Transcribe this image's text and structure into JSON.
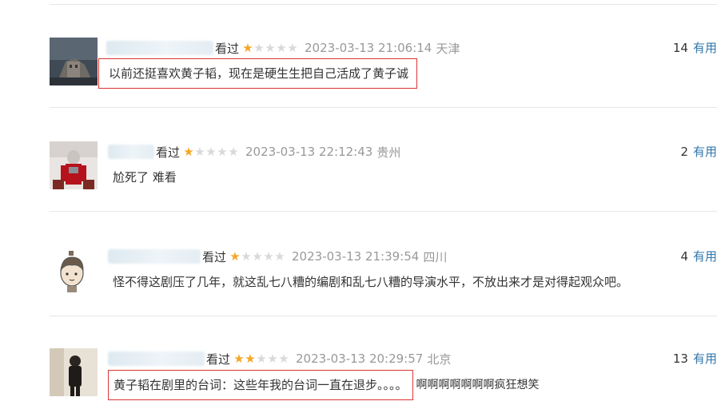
{
  "comments": [
    {
      "status": "看过",
      "rating": 1,
      "time": "2023-03-13 21:06:14",
      "location": "天津",
      "votes": "14",
      "useful_label": "有用",
      "text": "以前还挺喜欢黄子韬，现在是硬生生把自己活成了黄子诚",
      "text_after": ""
    },
    {
      "status": "看过",
      "rating": 1,
      "time": "2023-03-13 22:12:43",
      "location": "贵州",
      "votes": "2",
      "useful_label": "有用",
      "text": "尬死了 难看",
      "text_after": ""
    },
    {
      "status": "看过",
      "rating": 1,
      "time": "2023-03-13 21:39:54",
      "location": "四川",
      "votes": "4",
      "useful_label": "有用",
      "text": "怪不得这剧压了几年，就这乱七八糟的编剧和乱七八糟的导演水平，不放出来才是对得起观众吧。",
      "text_after": ""
    },
    {
      "status": "看过",
      "rating": 2,
      "time": "2023-03-13 20:29:57",
      "location": "北京",
      "votes": "13",
      "useful_label": "有用",
      "text": "黄子韬在剧里的台词：这些年我的台词一直在退步。。。。",
      "text_after": "啊啊啊啊啊啊啊疯狂想笑"
    }
  ],
  "colors": {
    "star_on": "#f5a623",
    "star_off": "#d9d9d9",
    "highlight_border": "#dd3333",
    "link": "#3377aa",
    "meta": "#999999"
  }
}
